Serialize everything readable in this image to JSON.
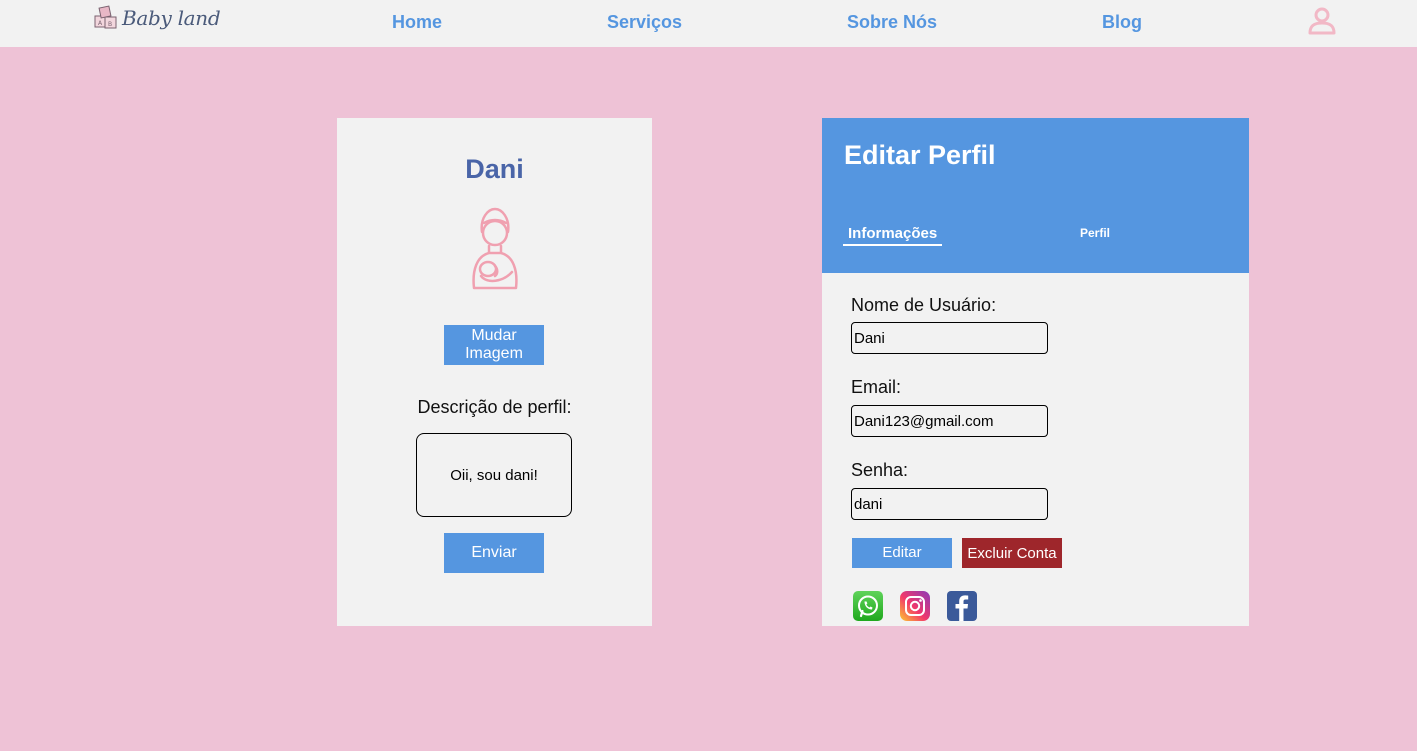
{
  "brand": {
    "name": "Baby land"
  },
  "nav": {
    "home": "Home",
    "servicos": "Serviços",
    "sobre": "Sobre Nós",
    "blog": "Blog"
  },
  "profile": {
    "name": "Dani",
    "change_image_label": "Mudar Imagem",
    "description_label": "Descrição de perfil:",
    "description_value": "Oii, sou dani!",
    "send_label": "Enviar"
  },
  "edit": {
    "title": "Editar Perfil",
    "tabs": [
      "Informações",
      "Perfil"
    ],
    "username_label": "Nome de Usuário:",
    "username_value": "Dani",
    "email_label": "Email:",
    "email_value": "Dani123@gmail.com",
    "password_label": "Senha:",
    "password_value": "dani",
    "edit_button": "Editar",
    "delete_button": "Excluir Conta"
  },
  "icons": {
    "logo": "baby-blocks-icon",
    "user": "user-icon",
    "avatar": "mother-baby-icon",
    "social": [
      "whatsapp-icon",
      "instagram-icon",
      "facebook-icon"
    ]
  },
  "colors": {
    "background": "#eec2d6",
    "accent": "#5596e0",
    "title": "#4a65a8",
    "danger": "#9e262b",
    "avatar": "#f0a0b0"
  }
}
